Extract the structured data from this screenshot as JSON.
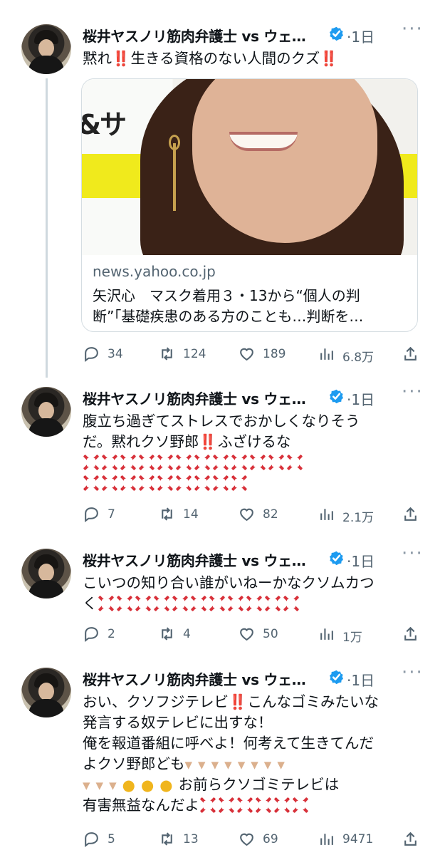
{
  "tweets": [
    {
      "author": "桜井ヤスノリ筋肉弁護士 vs ウェ…",
      "time": "·1日",
      "more_icon": "ellipsis-icon",
      "verified_icon": "verified-badge-icon",
      "text_lines": [
        [
          "黙れ",
          "‼️",
          "生きる資格のない人間のクズ",
          "‼️"
        ]
      ],
      "card": {
        "domain": "news.yahoo.co.jp",
        "title_lines": [
          "矢沢心　マスク着用３・13から“個人の判",
          "断”「基礎疾患のある方のことも…判断を…"
        ]
      },
      "stats": {
        "replies": "34",
        "retweets": "124",
        "likes": "189",
        "views": "6.8万"
      }
    },
    {
      "author": "桜井ヤスノリ筋肉弁護士 vs ウェ…",
      "time": "·1日",
      "text_lines": [
        [
          "腹立ち過ぎてストレスでおかしくなりそう"
        ],
        [
          "だ。黙れクソ野郎",
          "‼️",
          "ふざけるな"
        ]
      ],
      "anger_rows": [
        12,
        9
      ],
      "stats": {
        "replies": "7",
        "retweets": "14",
        "likes": "82",
        "views": "2.1万"
      }
    },
    {
      "author": "桜井ヤスノリ筋肉弁護士 vs ウェ…",
      "time": "·1日",
      "text_lines": [
        [
          "こいつの知り合い誰がいねーかなクソムカつ"
        ],
        [
          "く"
        ]
      ],
      "anger_rows": [
        11
      ],
      "stats": {
        "replies": "2",
        "retweets": "4",
        "likes": "50",
        "views": "1万"
      }
    },
    {
      "author": "桜井ヤスノリ筋肉弁護士 vs ウェ…",
      "time": "·1日",
      "text_lines": [
        [
          "おい、クソフジテレビ",
          "‼️",
          "こんなゴミみたいな"
        ],
        [
          "発言する奴テレビに出すな！"
        ],
        [
          "俺を報道番組に呼べよ！何考えて生きてんだ"
        ],
        [
          "よクソ野郎ども"
        ],
        [
          ""
        ],
        [
          "有害無益なんだよ"
        ]
      ],
      "fourth_line_extra": "お前らクソゴミテレビは",
      "anger_count": 6,
      "stats": {
        "replies": "5",
        "retweets": "13",
        "likes": "69",
        "views": "9471"
      }
    }
  ]
}
